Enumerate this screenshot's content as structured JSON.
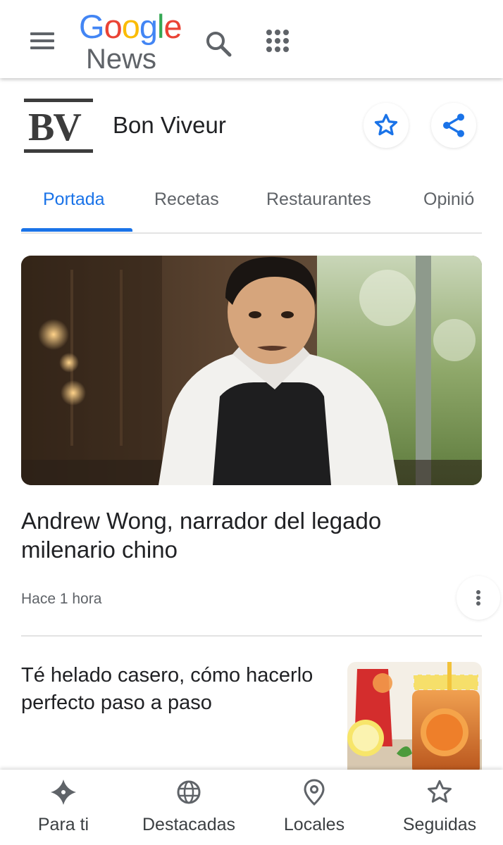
{
  "app": {
    "logo_google": [
      "G",
      "o",
      "o",
      "g",
      "l",
      "e"
    ],
    "logo_google_colors": [
      "#4285F4",
      "#EA4335",
      "#FBBC05",
      "#4285F4",
      "#34A853",
      "#EA4335"
    ],
    "logo_news": "News"
  },
  "toolbar": {
    "menu_icon": "menu-icon",
    "search_icon": "search-icon",
    "apps_icon": "apps-grid-icon"
  },
  "publisher": {
    "logo_text": "BV",
    "name": "Bon Viveur",
    "follow_icon": "star-outline-icon",
    "share_icon": "share-icon",
    "accent": "#1a73e8"
  },
  "tabs": [
    {
      "label": "Portada",
      "active": true
    },
    {
      "label": "Recetas",
      "active": false
    },
    {
      "label": "Restaurantes",
      "active": false
    },
    {
      "label": "Opinió",
      "active": false
    }
  ],
  "articles": [
    {
      "title": "Andrew Wong, narrador del legado milenario chino",
      "time": "Hace 1 hora",
      "image": "chef portrait photo"
    },
    {
      "title": "Té helado casero, cómo hacerlo perfecto paso a paso",
      "image": "iced tea jars photo"
    }
  ],
  "bottom_nav": [
    {
      "label": "Para ti",
      "icon": "para-ti-diamond-icon"
    },
    {
      "label": "Destacadas",
      "icon": "globe-icon"
    },
    {
      "label": "Locales",
      "icon": "location-pin-icon"
    },
    {
      "label": "Seguidas",
      "icon": "star-outline-icon"
    }
  ]
}
